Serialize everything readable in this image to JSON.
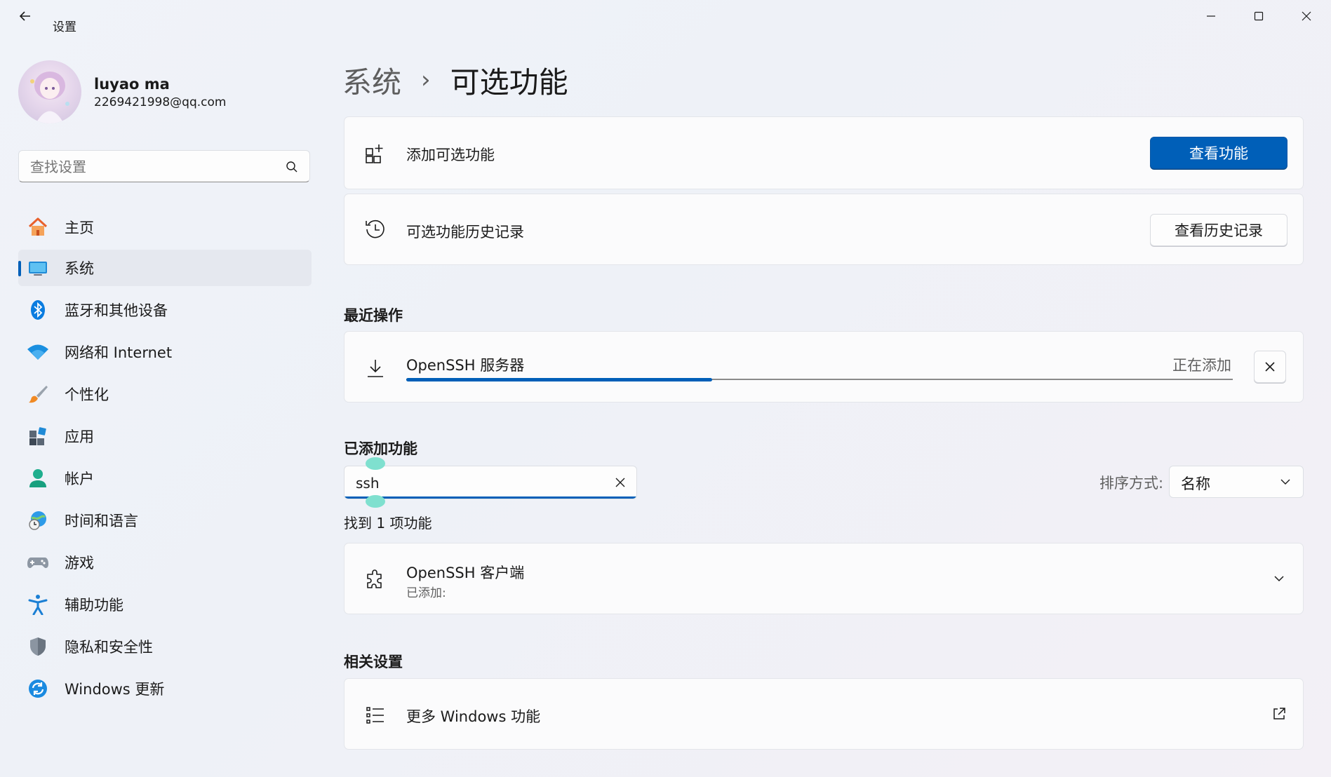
{
  "window": {
    "title": "设置",
    "back_icon": "back-arrow-icon",
    "controls": [
      "minimize-icon",
      "maximize-icon",
      "close-icon"
    ]
  },
  "profile": {
    "name": "luyao ma",
    "email": "2269421998@qq.com"
  },
  "search": {
    "placeholder": "查找设置",
    "icon": "search-icon"
  },
  "sidebar": {
    "items": [
      {
        "label": "主页",
        "icon": "home-icon"
      },
      {
        "label": "系统",
        "icon": "system-display-icon",
        "active": true
      },
      {
        "label": "蓝牙和其他设备",
        "icon": "bluetooth-icon"
      },
      {
        "label": "网络和 Internet",
        "icon": "wifi-icon"
      },
      {
        "label": "个性化",
        "icon": "paintbrush-icon"
      },
      {
        "label": "应用",
        "icon": "apps-icon"
      },
      {
        "label": "帐户",
        "icon": "account-icon"
      },
      {
        "label": "时间和语言",
        "icon": "globe-clock-icon"
      },
      {
        "label": "游戏",
        "icon": "gamepad-icon"
      },
      {
        "label": "辅助功能",
        "icon": "accessibility-icon"
      },
      {
        "label": "隐私和安全性",
        "icon": "shield-icon"
      },
      {
        "label": "Windows 更新",
        "icon": "update-icon"
      }
    ]
  },
  "breadcrumb": {
    "parent": "系统",
    "separator": "›",
    "current": "可选功能"
  },
  "add_feature": {
    "label": "添加可选功能",
    "button": "查看功能",
    "icon": "add-feature-icon"
  },
  "history": {
    "label": "可选功能历史记录",
    "button": "查看历史记录",
    "icon": "history-icon"
  },
  "recent": {
    "title": "最近操作",
    "item": {
      "name": "OpenSSH 服务器",
      "status": "正在添加",
      "progress": 0.37,
      "icon": "download-icon",
      "cancel_icon": "close-icon"
    }
  },
  "installed": {
    "title": "已添加功能",
    "search_value": "ssh",
    "sort_label": "排序方式:",
    "sort_value": "名称",
    "result_count": "找到 1 项功能",
    "items": [
      {
        "name": "OpenSSH 客户端",
        "status": "已添加:",
        "icon": "puzzle-icon"
      }
    ]
  },
  "related": {
    "title": "相关设置",
    "item": {
      "label": "更多 Windows 功能",
      "icon": "list-icon",
      "link_icon": "external-link-icon"
    }
  },
  "colors": {
    "accent": "#005fb8",
    "background": "#eef1f8",
    "card": "#fbfbfc"
  }
}
